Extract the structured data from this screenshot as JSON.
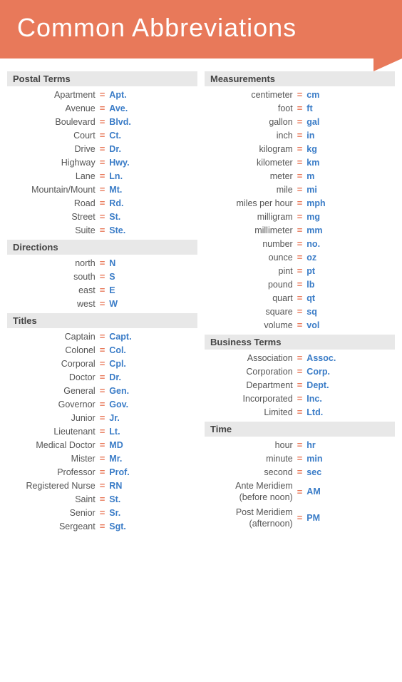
{
  "header": {
    "title": "Common Abbreviations"
  },
  "left_column": {
    "sections": [
      {
        "id": "postal",
        "header": "Postal Terms",
        "items": [
          {
            "term": "Apartment",
            "abbr": "Apt."
          },
          {
            "term": "Avenue",
            "abbr": "Ave."
          },
          {
            "term": "Boulevard",
            "abbr": "Blvd."
          },
          {
            "term": "Court",
            "abbr": "Ct."
          },
          {
            "term": "Drive",
            "abbr": "Dr."
          },
          {
            "term": "Highway",
            "abbr": "Hwy."
          },
          {
            "term": "Lane",
            "abbr": "Ln."
          },
          {
            "term": "Mountain/Mount",
            "abbr": "Mt."
          },
          {
            "term": "Road",
            "abbr": "Rd."
          },
          {
            "term": "Street",
            "abbr": "St."
          },
          {
            "term": "Suite",
            "abbr": "Ste."
          }
        ]
      },
      {
        "id": "directions",
        "header": "Directions",
        "items": [
          {
            "term": "north",
            "abbr": "N"
          },
          {
            "term": "south",
            "abbr": "S"
          },
          {
            "term": "east",
            "abbr": "E"
          },
          {
            "term": "west",
            "abbr": "W"
          }
        ]
      },
      {
        "id": "titles",
        "header": "Titles",
        "items": [
          {
            "term": "Captain",
            "abbr": "Capt."
          },
          {
            "term": "Colonel",
            "abbr": "Col."
          },
          {
            "term": "Corporal",
            "abbr": "Cpl."
          },
          {
            "term": "Doctor",
            "abbr": "Dr."
          },
          {
            "term": "General",
            "abbr": "Gen."
          },
          {
            "term": "Governor",
            "abbr": "Gov."
          },
          {
            "term": "Junior",
            "abbr": "Jr."
          },
          {
            "term": "Lieutenant",
            "abbr": "Lt."
          },
          {
            "term": "Medical Doctor",
            "abbr": "MD"
          },
          {
            "term": "Mister",
            "abbr": "Mr."
          },
          {
            "term": "Professor",
            "abbr": "Prof."
          },
          {
            "term": "Registered Nurse",
            "abbr": "RN"
          },
          {
            "term": "Saint",
            "abbr": "St."
          },
          {
            "term": "Senior",
            "abbr": "Sr."
          },
          {
            "term": "Sergeant",
            "abbr": "Sgt."
          }
        ]
      }
    ]
  },
  "right_column": {
    "sections": [
      {
        "id": "measurements",
        "header": "Measurements",
        "items": [
          {
            "term": "centimeter",
            "abbr": "cm"
          },
          {
            "term": "foot",
            "abbr": "ft"
          },
          {
            "term": "gallon",
            "abbr": "gal"
          },
          {
            "term": "inch",
            "abbr": "in"
          },
          {
            "term": "kilogram",
            "abbr": "kg"
          },
          {
            "term": "kilometer",
            "abbr": "km"
          },
          {
            "term": "meter",
            "abbr": "m"
          },
          {
            "term": "mile",
            "abbr": "mi"
          },
          {
            "term": "miles per hour",
            "abbr": "mph"
          },
          {
            "term": "milligram",
            "abbr": "mg"
          },
          {
            "term": "millimeter",
            "abbr": "mm"
          },
          {
            "term": "number",
            "abbr": "no."
          },
          {
            "term": "ounce",
            "abbr": "oz"
          },
          {
            "term": "pint",
            "abbr": "pt"
          },
          {
            "term": "pound",
            "abbr": "lb"
          },
          {
            "term": "quart",
            "abbr": "qt"
          },
          {
            "term": "square",
            "abbr": "sq"
          },
          {
            "term": "volume",
            "abbr": "vol"
          }
        ]
      },
      {
        "id": "business",
        "header": "Business Terms",
        "items": [
          {
            "term": "Association",
            "abbr": "Assoc."
          },
          {
            "term": "Corporation",
            "abbr": "Corp."
          },
          {
            "term": "Department",
            "abbr": "Dept."
          },
          {
            "term": "Incorporated",
            "abbr": "Inc."
          },
          {
            "term": "Limited",
            "abbr": "Ltd."
          }
        ]
      },
      {
        "id": "time",
        "header": "Time",
        "items": [
          {
            "term": "hour",
            "abbr": "hr"
          },
          {
            "term": "minute",
            "abbr": "min"
          },
          {
            "term": "second",
            "abbr": "sec"
          }
        ],
        "multiline_items": [
          {
            "term": "Ante Meridiem\n(before noon)",
            "abbr": "AM"
          },
          {
            "term": "Post Meridiem\n(afternoon)",
            "abbr": "PM"
          }
        ]
      }
    ]
  },
  "equals_sign": "="
}
